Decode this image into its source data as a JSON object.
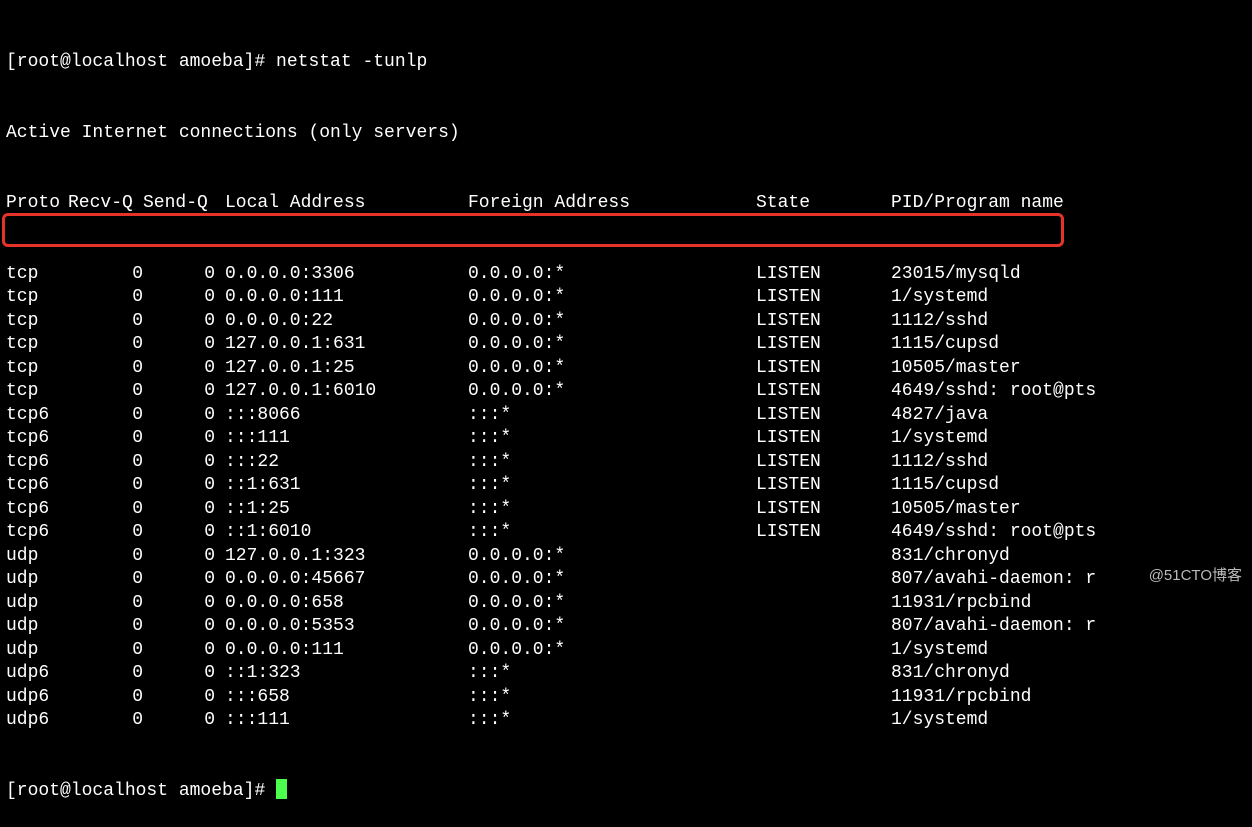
{
  "prompt_line": "[root@localhost amoeba]# netstat -tunlp",
  "title_line": "Active Internet connections (only servers)",
  "header": {
    "proto": "Proto",
    "recvq": "Recv-Q",
    "sendq": "Send-Q",
    "local": "Local Address",
    "foreign": "Foreign Address",
    "state": "State",
    "prog": "PID/Program name"
  },
  "rows": [
    {
      "proto": "tcp",
      "recvq": "0",
      "sendq": "0",
      "local": "0.0.0.0:3306",
      "foreign": "0.0.0.0:*",
      "state": "LISTEN",
      "prog": "23015/mysqld"
    },
    {
      "proto": "tcp",
      "recvq": "0",
      "sendq": "0",
      "local": "0.0.0.0:111",
      "foreign": "0.0.0.0:*",
      "state": "LISTEN",
      "prog": "1/systemd"
    },
    {
      "proto": "tcp",
      "recvq": "0",
      "sendq": "0",
      "local": "0.0.0.0:22",
      "foreign": "0.0.0.0:*",
      "state": "LISTEN",
      "prog": "1112/sshd"
    },
    {
      "proto": "tcp",
      "recvq": "0",
      "sendq": "0",
      "local": "127.0.0.1:631",
      "foreign": "0.0.0.0:*",
      "state": "LISTEN",
      "prog": "1115/cupsd"
    },
    {
      "proto": "tcp",
      "recvq": "0",
      "sendq": "0",
      "local": "127.0.0.1:25",
      "foreign": "0.0.0.0:*",
      "state": "LISTEN",
      "prog": "10505/master"
    },
    {
      "proto": "tcp",
      "recvq": "0",
      "sendq": "0",
      "local": "127.0.0.1:6010",
      "foreign": "0.0.0.0:*",
      "state": "LISTEN",
      "prog": "4649/sshd: root@pts"
    },
    {
      "proto": "tcp6",
      "recvq": "0",
      "sendq": "0",
      "local": ":::8066",
      "foreign": ":::*",
      "state": "LISTEN",
      "prog": "4827/java"
    },
    {
      "proto": "tcp6",
      "recvq": "0",
      "sendq": "0",
      "local": ":::111",
      "foreign": ":::*",
      "state": "LISTEN",
      "prog": "1/systemd"
    },
    {
      "proto": "tcp6",
      "recvq": "0",
      "sendq": "0",
      "local": ":::22",
      "foreign": ":::*",
      "state": "LISTEN",
      "prog": "1112/sshd"
    },
    {
      "proto": "tcp6",
      "recvq": "0",
      "sendq": "0",
      "local": "::1:631",
      "foreign": ":::*",
      "state": "LISTEN",
      "prog": "1115/cupsd"
    },
    {
      "proto": "tcp6",
      "recvq": "0",
      "sendq": "0",
      "local": "::1:25",
      "foreign": ":::*",
      "state": "LISTEN",
      "prog": "10505/master"
    },
    {
      "proto": "tcp6",
      "recvq": "0",
      "sendq": "0",
      "local": "::1:6010",
      "foreign": ":::*",
      "state": "LISTEN",
      "prog": "4649/sshd: root@pts"
    },
    {
      "proto": "udp",
      "recvq": "0",
      "sendq": "0",
      "local": "127.0.0.1:323",
      "foreign": "0.0.0.0:*",
      "state": "",
      "prog": "831/chronyd"
    },
    {
      "proto": "udp",
      "recvq": "0",
      "sendq": "0",
      "local": "0.0.0.0:45667",
      "foreign": "0.0.0.0:*",
      "state": "",
      "prog": "807/avahi-daemon: r"
    },
    {
      "proto": "udp",
      "recvq": "0",
      "sendq": "0",
      "local": "0.0.0.0:658",
      "foreign": "0.0.0.0:*",
      "state": "",
      "prog": "11931/rpcbind"
    },
    {
      "proto": "udp",
      "recvq": "0",
      "sendq": "0",
      "local": "0.0.0.0:5353",
      "foreign": "0.0.0.0:*",
      "state": "",
      "prog": "807/avahi-daemon: r"
    },
    {
      "proto": "udp",
      "recvq": "0",
      "sendq": "0",
      "local": "0.0.0.0:111",
      "foreign": "0.0.0.0:*",
      "state": "",
      "prog": "1/systemd"
    },
    {
      "proto": "udp6",
      "recvq": "0",
      "sendq": "0",
      "local": "::1:323",
      "foreign": ":::*",
      "state": "",
      "prog": "831/chronyd"
    },
    {
      "proto": "udp6",
      "recvq": "0",
      "sendq": "0",
      "local": ":::658",
      "foreign": ":::*",
      "state": "",
      "prog": "11931/rpcbind"
    },
    {
      "proto": "udp6",
      "recvq": "0",
      "sendq": "0",
      "local": ":::111",
      "foreign": ":::*",
      "state": "",
      "prog": "1/systemd"
    }
  ],
  "bottom_prompt": "[root@localhost amoeba]# ",
  "watermark": "@51CTO博客"
}
